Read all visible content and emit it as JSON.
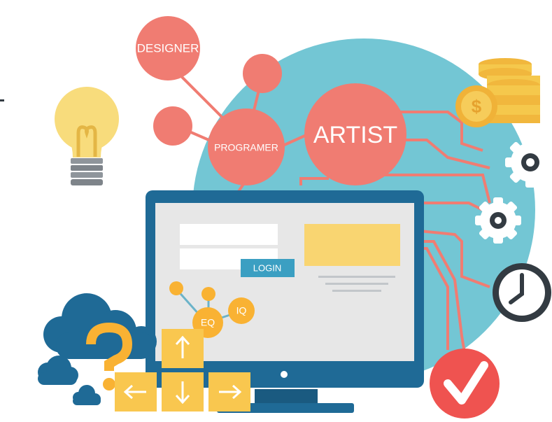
{
  "labels": {
    "designer": "DESIGNER",
    "programer": "PROGRAMER",
    "artist": "ARTIST",
    "login": "LOGIN",
    "eq": "EQ",
    "iq": "IQ"
  },
  "icons": [
    "light-bulb-icon",
    "coins-icon",
    "gear-icon",
    "clock-icon",
    "checkmark-icon",
    "cloud-icon",
    "question-mark-icon",
    "arrow-up-key-icon",
    "arrow-left-key-icon",
    "arrow-down-key-icon",
    "arrow-right-key-icon"
  ],
  "colors": {
    "sky": "#73c6d4",
    "coral": "#f07c72",
    "monitor": "#1f6a96",
    "screen": "#e7e7e7",
    "yellow": "#f9c74f",
    "dark": "#333b42"
  }
}
